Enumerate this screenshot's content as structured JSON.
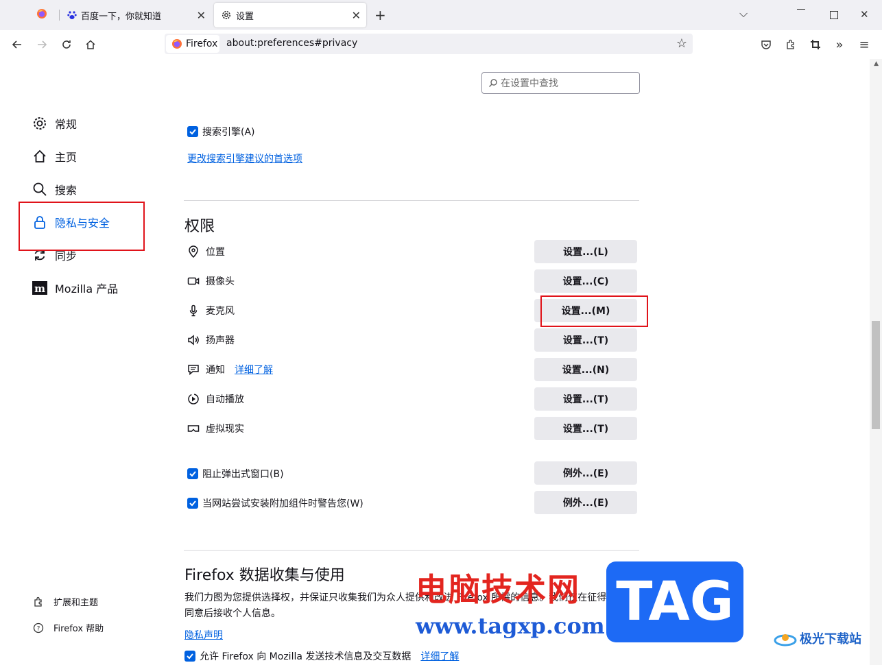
{
  "tabs": [
    {
      "title": "",
      "icon": "firefox-icon"
    },
    {
      "title": "百度一下，你就知道",
      "icon": "baidu-paw-icon"
    },
    {
      "title": "设置",
      "icon": "gear-icon"
    }
  ],
  "toolbar": {
    "identity_label": "Firefox",
    "url": "about:preferences#privacy"
  },
  "search": {
    "placeholder": "在设置中查找"
  },
  "sidebar": {
    "items": [
      {
        "label": "常规",
        "icon": "gear-icon"
      },
      {
        "label": "主页",
        "icon": "home-icon"
      },
      {
        "label": "搜索",
        "icon": "search-icon"
      },
      {
        "label": "隐私与安全",
        "icon": "lock-icon"
      },
      {
        "label": "同步",
        "icon": "sync-icon"
      },
      {
        "label": "Mozilla 产品",
        "icon": "mozilla-icon"
      }
    ],
    "footer": [
      {
        "label": "扩展和主题",
        "icon": "puzzle-icon"
      },
      {
        "label": "Firefox 帮助",
        "icon": "help-icon"
      }
    ]
  },
  "main": {
    "search_engine_checkbox": "搜索引擎(A)",
    "change_search_link": "更改搜索引擎建议的首选项",
    "permissions_heading": "权限",
    "permissions": [
      {
        "label": "位置",
        "button": "设置...(L)",
        "icon": "location-icon"
      },
      {
        "label": "摄像头",
        "button": "设置...(C)",
        "icon": "camera-icon"
      },
      {
        "label": "麦克风",
        "button": "设置...(M)",
        "icon": "microphone-icon"
      },
      {
        "label": "扬声器",
        "button": "设置...(T)",
        "icon": "speaker-icon"
      },
      {
        "label": "通知",
        "button": "设置...(N)",
        "icon": "notification-icon",
        "link": "详细了解"
      },
      {
        "label": "自动播放",
        "button": "设置...(T)",
        "icon": "autoplay-icon"
      },
      {
        "label": "虚拟现实",
        "button": "设置...(T)",
        "icon": "vr-icon"
      }
    ],
    "block_popups": {
      "label": "阻止弹出式窗口(B)",
      "button": "例外...(E)"
    },
    "warn_addons": {
      "label": "当网站尝试安装附加组件时警告您(W)",
      "button": "例外...(E)"
    },
    "data_heading": "Firefox 数据收集与使用",
    "data_desc": "我们力图为您提供选择权，并保证只收集我们为众人提供和改进 Firefox 所需的信息。我们仅在征得您的同意后接收个人信息。",
    "privacy_link": "隐私声明",
    "telemetry_checkbox": "允许 Firefox 向 Mozilla 发送技术信息及交互数据",
    "telemetry_link": "详细了解"
  },
  "watermark": {
    "text": "电脑技术网",
    "url": "www.tagxp.com",
    "badge": "TAG",
    "site": "极光下载站"
  },
  "colors": {
    "accent": "#0061e0",
    "highlight_box": "#e0131a",
    "button_bg": "#e9e9ed"
  }
}
